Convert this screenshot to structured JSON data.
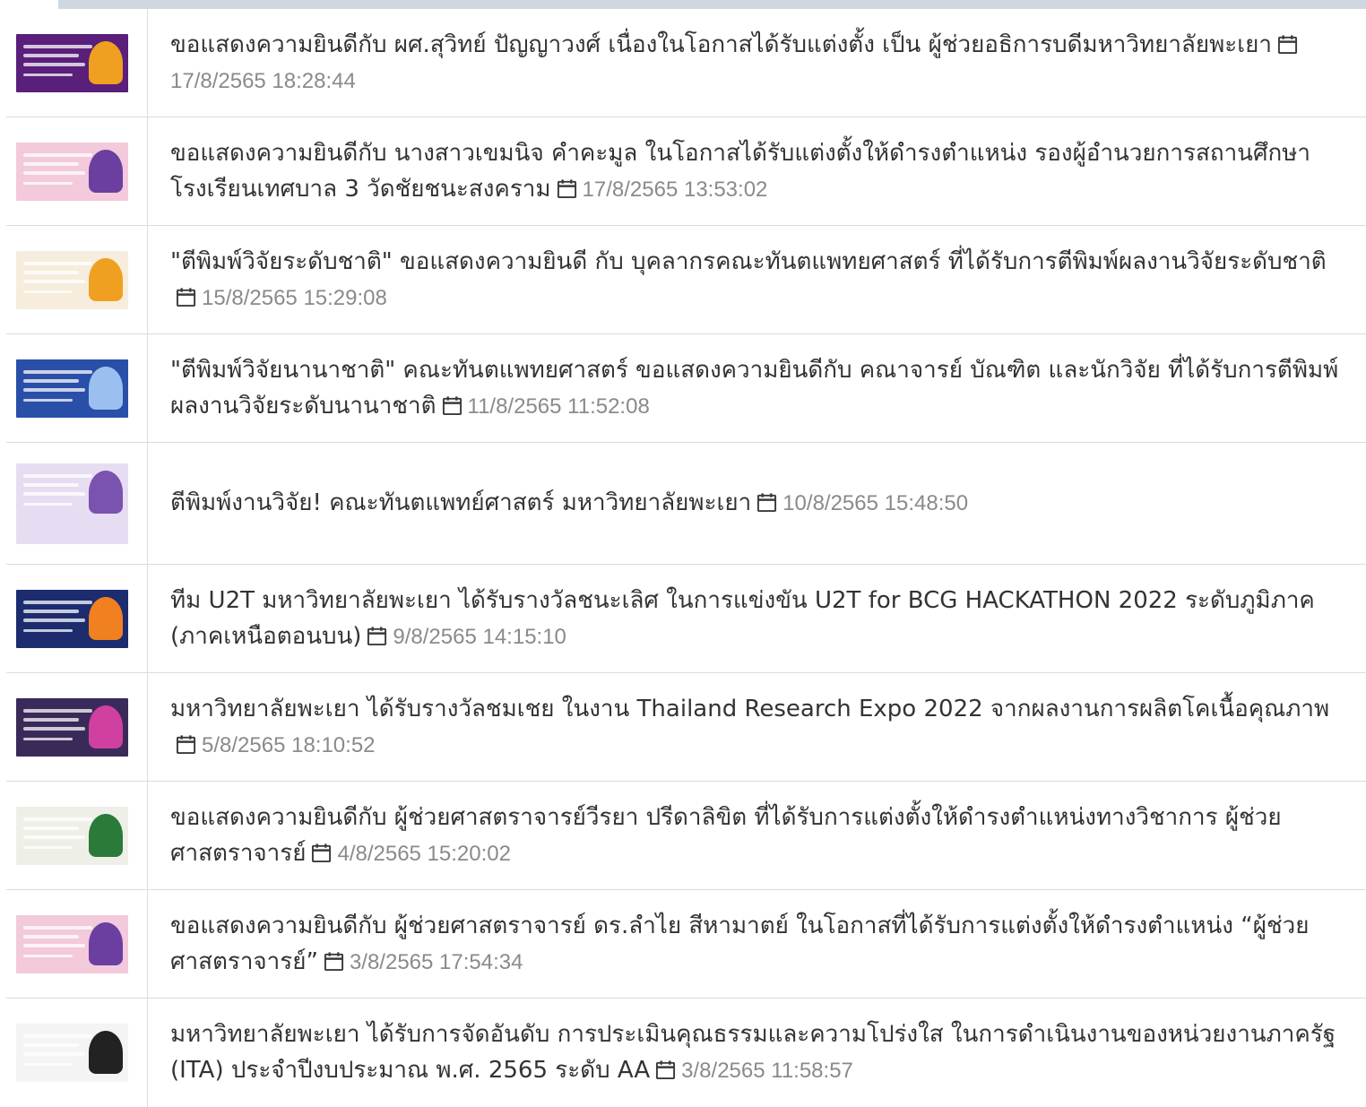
{
  "news": [
    {
      "title": "ขอแสดงความยินดีกับ ผศ.สุวิทย์ ปัญญาวงศ์ เนื่องในโอกาสได้รับแต่งตั้ง เป็น ผู้ช่วยอธิการบดีมหาวิทยาลัยพะเยา",
      "date": "17/8/2565 18:28:44",
      "thumb_icon": "news-thumbnail-icon",
      "thumb_color": "#5a1f7a",
      "thumb_accent": "#f0a020"
    },
    {
      "title": "ขอแสดงความยินดีกับ นางสาวเขมนิจ คำคะมูล ในโอกาสได้รับแต่งตั้งให้ดำรงตำแหน่ง รองผู้อำนวยการสถานศึกษา โรงเรียนเทศบาล 3 วัดชัยชนะสงคราม",
      "date": "17/8/2565 13:53:02",
      "thumb_icon": "news-thumbnail-icon",
      "thumb_color": "#f3c9dc",
      "thumb_accent": "#6b3fa0"
    },
    {
      "title": "\"ตีพิมพ์วิจัยระดับชาติ\" ขอแสดงความยินดี กับ บุคลากรคณะทันตแพทยศาสตร์ ที่ได้รับการตีพิมพ์ผลงานวิจัยระดับชาติ",
      "date": "15/8/2565 15:29:08",
      "thumb_icon": "news-thumbnail-icon",
      "thumb_color": "#f6eddc",
      "thumb_accent": "#f0a020"
    },
    {
      "title": "\"ตีพิมพ์วิจัยนานาชาติ\" คณะทันตแพทยศาสตร์ ขอแสดงความยินดีกับ คณาจารย์ บัณฑิต และนักวิจัย ที่ได้รับการตีพิมพ์ผลงานวิจัยระดับนานาชาติ",
      "date": "11/8/2565 11:52:08",
      "thumb_icon": "news-thumbnail-icon",
      "thumb_color": "#2a4fa8",
      "thumb_accent": "#9bc0f0"
    },
    {
      "title": "ตีพิมพ์งานวิจัย! คณะทันตแพทย์ศาสตร์ มหาวิทยาลัยพะเยา",
      "date": "10/8/2565 15:48:50",
      "thumb_icon": "news-thumbnail-icon",
      "thumb_color": "#e7ddf2",
      "thumb_accent": "#7a52b0"
    },
    {
      "title": "ทีม U2T มหาวิทยาลัยพะเยา ได้รับรางวัลชนะเลิศ ในการแข่งขัน U2T for BCG HACKATHON 2022 ระดับภูมิภาค (ภาคเหนือตอนบน)",
      "date": "9/8/2565 14:15:10",
      "thumb_icon": "news-thumbnail-icon",
      "thumb_color": "#1c2c6e",
      "thumb_accent": "#f08020"
    },
    {
      "title": "มหาวิทยาลัยพะเยา ได้รับรางวัลชมเชย ในงาน Thailand Research Expo 2022 จากผลงานการผลิตโคเนื้อคุณภาพ",
      "date": "5/8/2565 18:10:52",
      "thumb_icon": "news-thumbnail-icon",
      "thumb_color": "#3a2a5a",
      "thumb_accent": "#d040a0"
    },
    {
      "title": "ขอแสดงความยินดีกับ ผู้ช่วยศาสตราจารย์วีรยา ปรีดาลิขิต ที่ได้รับการแต่งตั้งให้ดำรงตำแหน่งทางวิชาการ ผู้ช่วยศาสตราจารย์",
      "date": "4/8/2565 15:20:02",
      "thumb_icon": "news-thumbnail-icon",
      "thumb_color": "#eef0e8",
      "thumb_accent": "#2a7a3a"
    },
    {
      "title": "ขอแสดงความยินดีกับ ผู้ช่วยศาสตราจารย์ ดร.ลำไย สีหามาตย์ ในโอกาสที่ได้รับการแต่งตั้งให้ดำรงตำแหน่ง “ผู้ช่วยศาสตราจารย์”",
      "date": "3/8/2565 17:54:34",
      "thumb_icon": "news-thumbnail-icon",
      "thumb_color": "#f3c9dc",
      "thumb_accent": "#6b3fa0"
    },
    {
      "title": "มหาวิทยาลัยพะเยา ได้รับการจัดอันดับ การประเมินคุณธรรมและความโปร่งใส ในการดำเนินงานของหน่วยงานภาครัฐ (ITA) ประจำปีงบประมาณ พ.ศ. 2565 ระดับ AA",
      "date": "3/8/2565 11:58:57",
      "thumb_icon": "news-thumbnail-icon",
      "thumb_color": "#f4f4f4",
      "thumb_accent": "#222222"
    }
  ],
  "calendar_icon": "calendar-icon",
  "colors": {
    "title": "#333333",
    "date": "#8a8a8a",
    "divider": "#dcdcdc",
    "top_strip": "#cfd8e0"
  }
}
